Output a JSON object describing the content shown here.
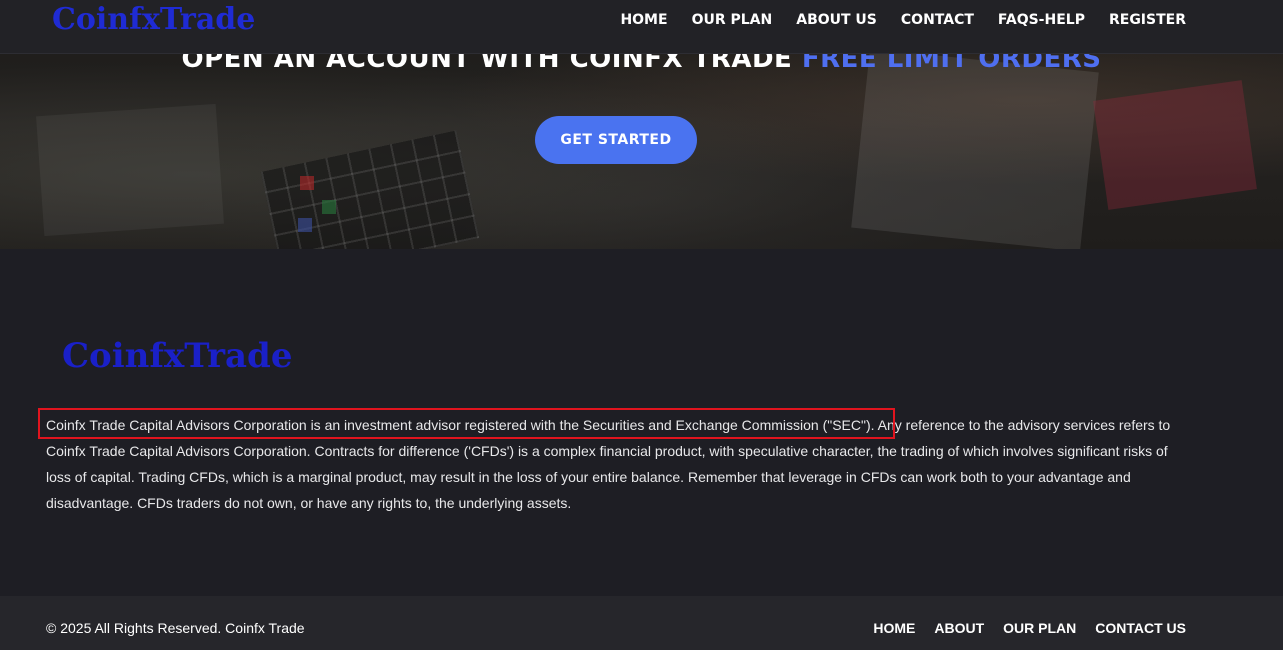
{
  "brand": {
    "logo_text": "CoinfxTrade"
  },
  "nav": {
    "items": [
      {
        "label": "HOME"
      },
      {
        "label": "OUR PLAN"
      },
      {
        "label": "ABOUT US"
      },
      {
        "label": "CONTACT"
      },
      {
        "label": "FAQS-HELP"
      },
      {
        "label": "REGISTER"
      }
    ]
  },
  "hero": {
    "title_main": "OPEN AN ACCOUNT WITH COINFX TRADE ",
    "title_accent": "FREE LIMIT ORDERS",
    "cta_label": "GET STARTED"
  },
  "about": {
    "logo_text": "CoinfxTrade",
    "highlighted_sentence": "Coinfx Trade Capital Advisors Corporation is an investment advisor registered with the Securities and Exchange Commission (\"SEC\").",
    "rest_text": " Any reference to the advisory services refers to Coinfx Trade Capital Advisors Corporation. Contracts for difference ('CFDs') is a complex financial product, with speculative character, the trading of which involves significant risks of loss of capital. Trading CFDs, which is a marginal product, may result in the loss of your entire balance. Remember that leverage in CFDs can work both to your advantage and disadvantage. CFDs traders do not own, or have any rights to, the underlying assets."
  },
  "footer": {
    "copyright": "© 2025 All Rights Reserved. Coinfx Trade",
    "links": [
      {
        "label": "HOME"
      },
      {
        "label": "ABOUT"
      },
      {
        "label": "OUR PLAN"
      },
      {
        "label": "CONTACT US"
      }
    ]
  },
  "colors": {
    "accent": "#4a73f0",
    "logo": "#1f2bd4",
    "highlight_border": "#e0141e",
    "page_bg": "#1e1e24"
  }
}
